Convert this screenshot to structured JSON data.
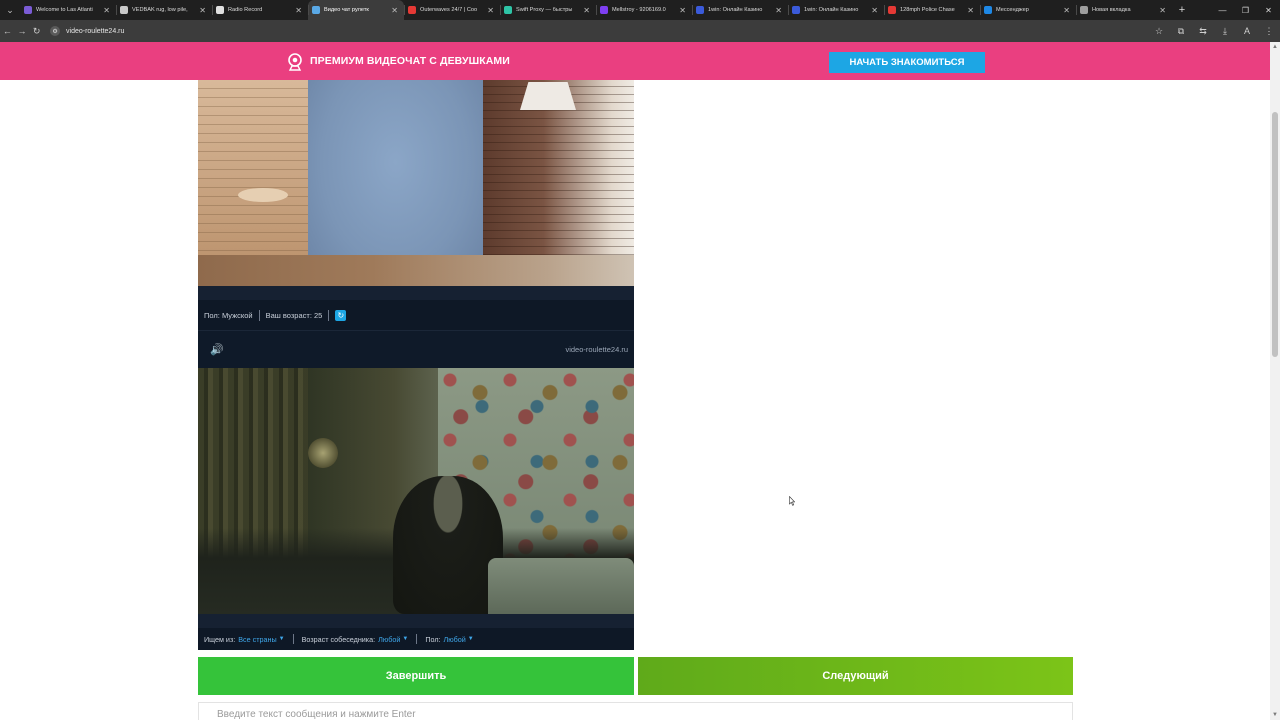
{
  "browser": {
    "tabs": [
      {
        "title": "Welcome to Las Atlanti",
        "color": "#7b5cd6",
        "active": false
      },
      {
        "title": "VEDBÄK rug, low pile,",
        "color": "#c9c9c9",
        "active": false
      },
      {
        "title": "Radio Record",
        "color": "#e0e0e0",
        "active": false
      },
      {
        "title": "Видео чат рулетк",
        "color": "#5aa9e6",
        "active": true
      },
      {
        "title": "Outerwaves 24/7 | Coo",
        "color": "#e53935",
        "active": false
      },
      {
        "title": "Swift Proxy — быстры",
        "color": "#2ec4a6",
        "active": false
      },
      {
        "title": "Mellstroy - 9206169.0",
        "color": "#7e3ff2",
        "active": false
      },
      {
        "title": "1win: Онлайн Казино",
        "color": "#3b5bdb",
        "active": false
      },
      {
        "title": "1win: Онлайн Казино",
        "color": "#3b5bdb",
        "active": false
      },
      {
        "title": "128mph Police Chase",
        "color": "#e53935",
        "active": false
      },
      {
        "title": "Мессенджер",
        "color": "#1e88e5",
        "active": false
      },
      {
        "title": "Новая вкладка",
        "color": "#9e9e9e",
        "active": false
      }
    ],
    "url": "video-roulette24.ru"
  },
  "promo": {
    "text": "ПРЕМИУМ ВИДЕОЧАТ С ДЕВУШКАМИ",
    "button": "НАЧАТЬ ЗНАКОМИТЬСЯ",
    "background_color": "#ea3f80",
    "button_color": "#1da6e4"
  },
  "self_info": {
    "gender": "Пол: Мужской",
    "age": "Ваш возраст: 25"
  },
  "partner": {
    "site_label": "video-roulette24.ru"
  },
  "filters": {
    "country_label": "Ищем из:",
    "country_value": "Все страны",
    "age_label": "Возраст собеседника:",
    "age_value": "Любой",
    "gender_label": "Пол:",
    "gender_value": "Любой"
  },
  "actions": {
    "end": "Завершить",
    "next": "Следующий",
    "end_color": "#35c33a",
    "next_color": "#7cc418"
  },
  "chat": {
    "placeholder": "Введите текст сообщения и нажмите Enter"
  }
}
